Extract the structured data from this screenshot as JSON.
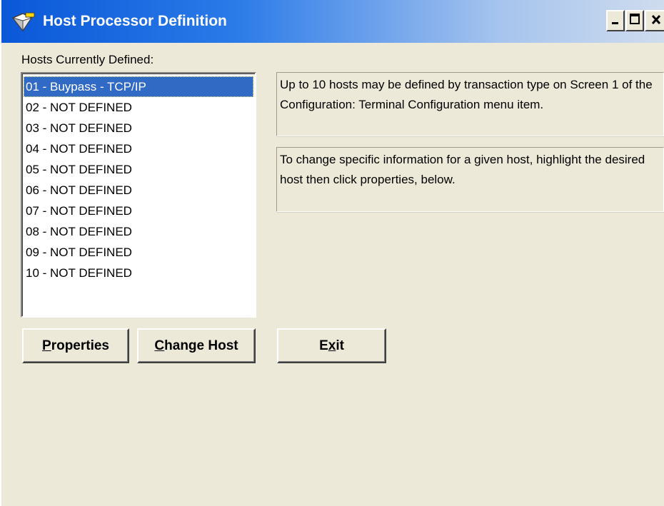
{
  "window": {
    "title": "Host Processor Definition",
    "icon": "host-processor-app-icon",
    "controls": {
      "minimize_icon": "minimize-icon",
      "maximize_icon": "maximize-icon",
      "close_icon": "close-icon"
    }
  },
  "hosts_label": "Hosts Currently Defined:",
  "hosts": [
    {
      "label": "01 - Buypass - TCP/IP",
      "selected": true
    },
    {
      "label": "02 - NOT DEFINED",
      "selected": false
    },
    {
      "label": "03 - NOT DEFINED",
      "selected": false
    },
    {
      "label": "04 - NOT DEFINED",
      "selected": false
    },
    {
      "label": "05 - NOT DEFINED",
      "selected": false
    },
    {
      "label": "06 - NOT DEFINED",
      "selected": false
    },
    {
      "label": "07 - NOT DEFINED",
      "selected": false
    },
    {
      "label": "08 - NOT DEFINED",
      "selected": false
    },
    {
      "label": "09 - NOT DEFINED",
      "selected": false
    },
    {
      "label": "10 - NOT DEFINED",
      "selected": false
    }
  ],
  "info": {
    "text1": "Up to 10 hosts may be defined by transaction type on Screen 1 of the Configuration:  Terminal Configuration menu item.",
    "text2": "To change specific information for a given host, highlight the desired host then click properties, below."
  },
  "buttons": {
    "properties": {
      "first": "P",
      "rest": "roperties"
    },
    "change_host": {
      "first": "C",
      "rest": "hange Host"
    },
    "exit": {
      "first": "E",
      "mnemonic": "x",
      "rest": "it"
    }
  },
  "colors": {
    "selection": "#316ac5",
    "window_bg": "#ece9d8",
    "titlebar_start": "#0a58d8"
  }
}
